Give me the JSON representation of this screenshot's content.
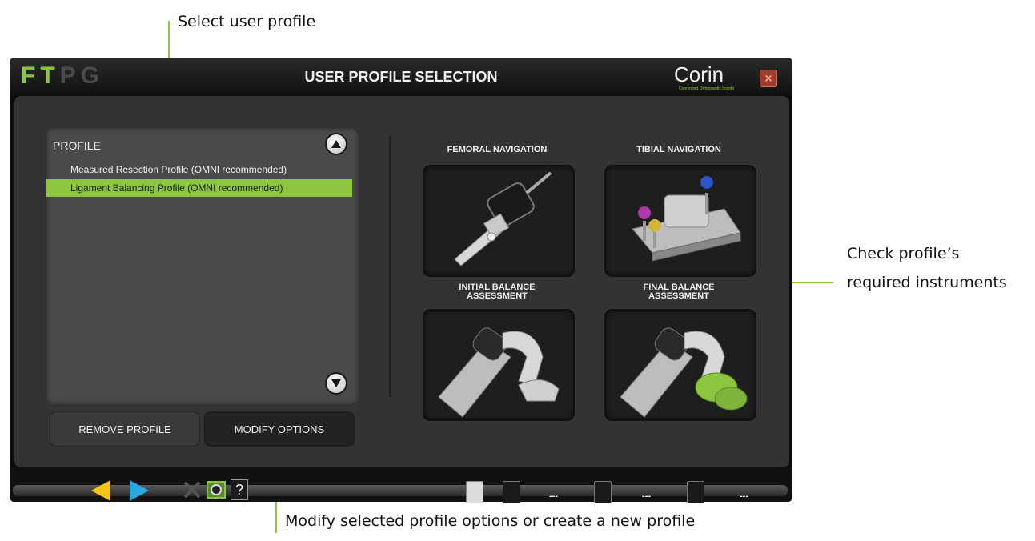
{
  "annotations": {
    "select_profile": "Select user profile",
    "check_instruments_line1": "Check profile’s",
    "check_instruments_line2": "required instruments",
    "modify_options": "Modify selected profile options or create a new profile"
  },
  "app": {
    "logo_letters": [
      "F",
      "T",
      "P",
      "G"
    ],
    "title": "USER PROFILE SELECTION",
    "brand": "Corin",
    "brand_subtitle": "Connected Orthopaedic Insight",
    "close_label": "×"
  },
  "profile_list": {
    "header": "PROFILE",
    "items": [
      {
        "label": "Measured Resection Profile (OMNI recommended)",
        "selected": false
      },
      {
        "label": "Ligament Balancing Profile (OMNI recommended)",
        "selected": true
      }
    ]
  },
  "buttons": {
    "remove_profile": "REMOVE PROFILE",
    "modify_options": "MODIFY OPTIONS"
  },
  "instruments": [
    {
      "label_line1": "FEMORAL NAVIGATION",
      "label_line2": ""
    },
    {
      "label_line1": "TIBIAL NAVIGATION",
      "label_line2": ""
    },
    {
      "label_line1": "INITIAL BALANCE",
      "label_line2": "ASSESSMENT"
    },
    {
      "label_line1": "FINAL BALANCE",
      "label_line2": "ASSESSMENT"
    }
  ],
  "bottom_bar": {
    "help_label": "?",
    "status_values": [
      "---",
      "---",
      "---"
    ]
  },
  "colors": {
    "accent_green": "#8cc63f",
    "logo_green": "#8cc63f",
    "logo_gray": "#4a4a4a",
    "back_arrow": "#f5c518",
    "forward_arrow": "#29a8e0"
  }
}
